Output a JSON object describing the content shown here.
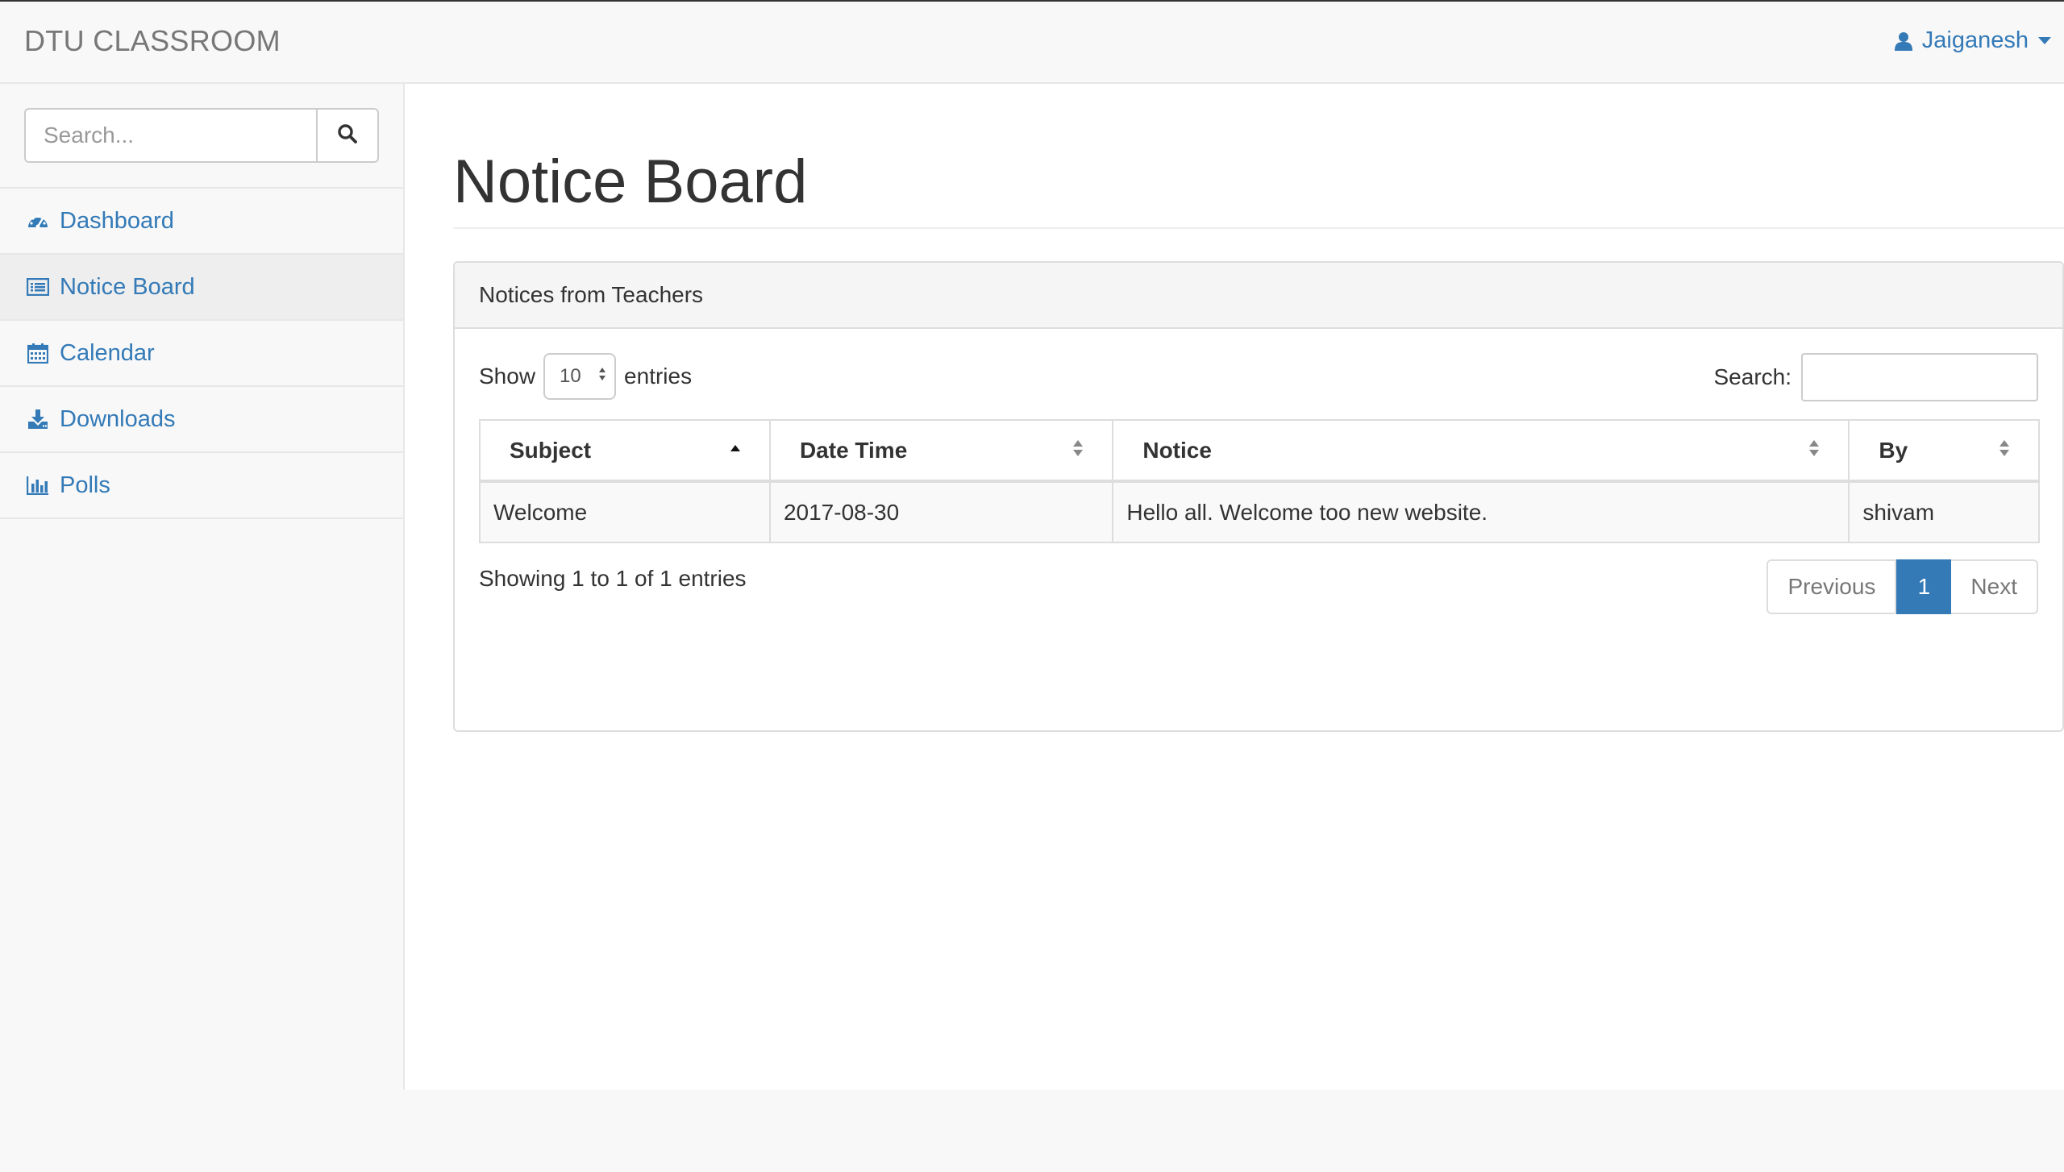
{
  "navbar": {
    "brand": "DTU CLASSROOM",
    "user_name": "Jaiganesh"
  },
  "sidebar": {
    "search_placeholder": "Search...",
    "items": [
      {
        "label": "Dashboard",
        "icon": "dashboard-icon",
        "active": false
      },
      {
        "label": "Notice Board",
        "icon": "list-alt-icon",
        "active": true
      },
      {
        "label": "Calendar",
        "icon": "calendar-icon",
        "active": false
      },
      {
        "label": "Downloads",
        "icon": "download-icon",
        "active": false
      },
      {
        "label": "Polls",
        "icon": "bar-chart-icon",
        "active": false
      }
    ]
  },
  "main": {
    "page_title": "Notice Board",
    "panel_title": "Notices from Teachers",
    "length": {
      "show_label": "Show",
      "value": "10",
      "entries_label": "entries"
    },
    "filter": {
      "label": "Search:",
      "value": ""
    },
    "table": {
      "columns": [
        "Subject",
        "Date Time",
        "Notice",
        "By"
      ],
      "sorted_column": "Subject",
      "rows": [
        [
          "Welcome",
          "2017-08-30",
          "Hello all. Welcome too new website.",
          "shivam"
        ]
      ]
    },
    "info": "Showing 1 to 1 of 1 entries",
    "pagination": {
      "previous": "Previous",
      "current": "1",
      "next": "Next"
    }
  },
  "colors": {
    "link": "#337ab7",
    "active_page": "#337ab7",
    "background": "#f8f8f8",
    "border": "#ddd"
  }
}
